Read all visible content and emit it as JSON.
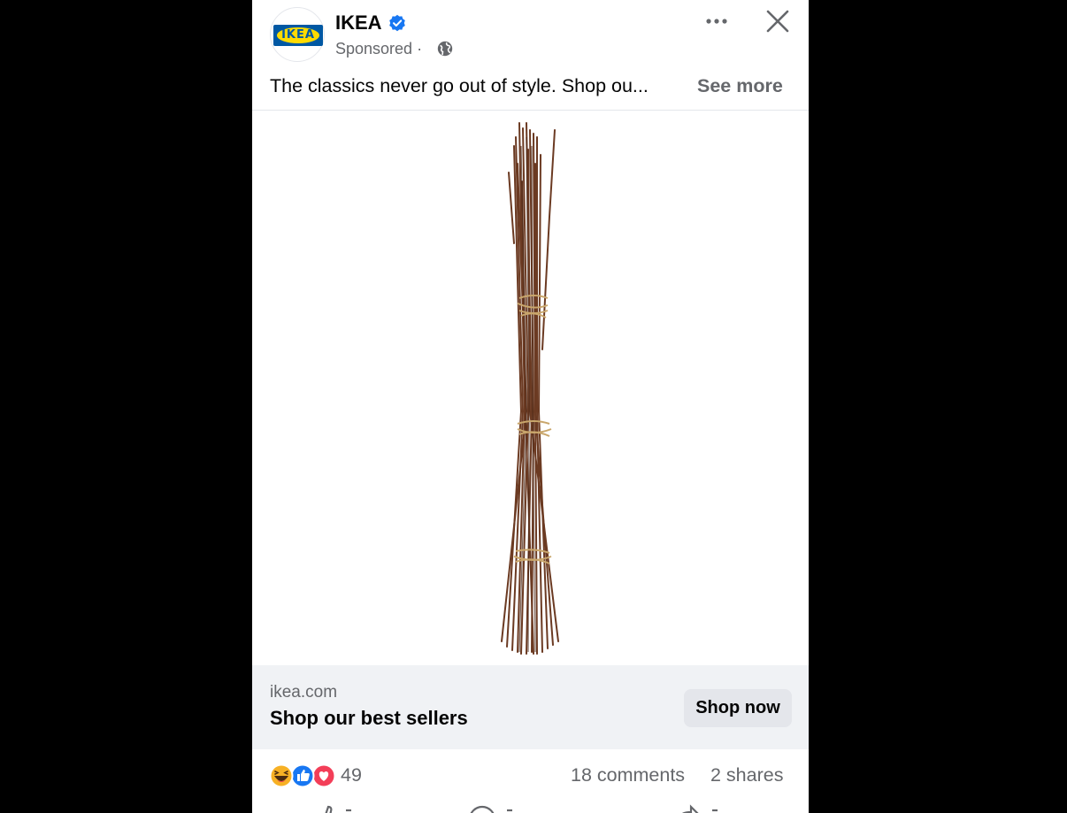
{
  "post": {
    "page_name": "IKEA",
    "sponsored_label": "Sponsored",
    "separator": "·",
    "text_truncated": "The classics never go out of style. Shop ou...",
    "see_more": "See more",
    "verified_badge_color": "#1877f2"
  },
  "logo": {
    "text": "IKEA",
    "colors": {
      "blue": "#0058a3",
      "yellow": "#ffdb00"
    }
  },
  "link": {
    "domain": "ikea.com",
    "headline": "Shop our best sellers",
    "cta": "Shop now"
  },
  "engagement": {
    "reactions_count": "49",
    "reaction_icons": [
      "haha-icon",
      "like-icon",
      "love-icon"
    ],
    "comments": "18 comments",
    "shares": "2 shares"
  },
  "actions": [
    "like-action-icon",
    "comment-action-icon",
    "share-action-icon"
  ]
}
